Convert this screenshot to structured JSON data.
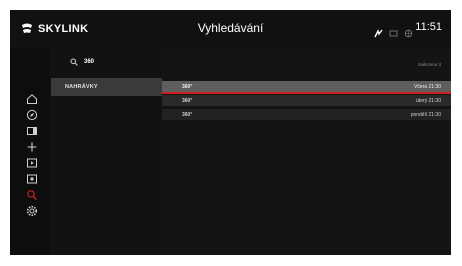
{
  "header": {
    "brand": "SKYLINK",
    "title": "Vyhledávání",
    "time": "11:51"
  },
  "search": {
    "query": "360",
    "category": "NAHRÁVKY",
    "found_count_label": "Nalezeno 3"
  },
  "results": [
    {
      "name": "360°",
      "when": "Včera 21:30"
    },
    {
      "name": "360°",
      "when": "úterý 21:30"
    },
    {
      "name": "360°",
      "when": "pondělí 21:30"
    }
  ],
  "sidebar": {
    "icons": [
      "home-icon",
      "compass-icon",
      "tv-guide-icon",
      "plus-icon",
      "play-icon",
      "record-icon",
      "search-icon",
      "settings-icon"
    ]
  },
  "colors": {
    "accent": "#d01f1f",
    "selected_row": "#5e5e5e",
    "active_category": "#3a3a3a"
  }
}
